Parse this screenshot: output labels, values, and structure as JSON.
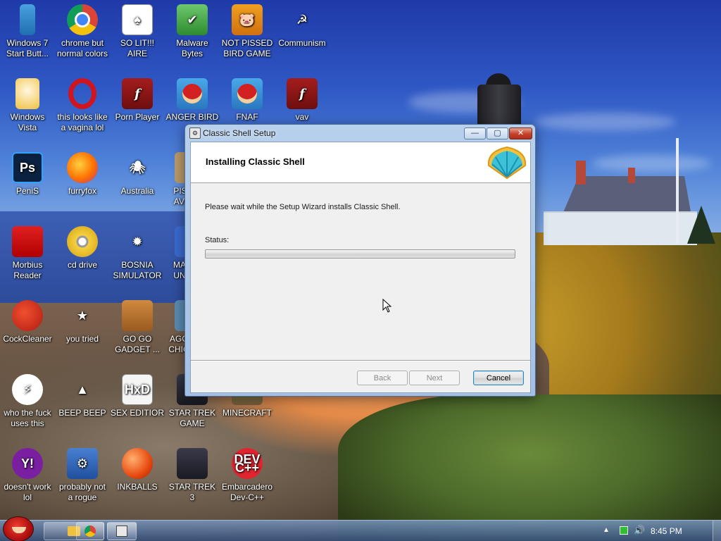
{
  "desktop": {
    "icons": [
      {
        "label": "Windows 7 Start Butt...",
        "glyph": "",
        "icon": "windows-7-start-button-icon"
      },
      {
        "label": "chrome but normal colors",
        "glyph": "",
        "icon": "chrome-icon"
      },
      {
        "label": "SO LIT!!! AIRE",
        "glyph": "♠",
        "icon": "solitaire-cards-icon"
      },
      {
        "label": "Malware Bytes",
        "glyph": "✔",
        "icon": "malwarebytes-shield-icon"
      },
      {
        "label": "NOT PISSED BIRD GAME",
        "glyph": "🐷",
        "icon": "green-pig-icon"
      },
      {
        "label": "Communism",
        "glyph": "☭",
        "icon": "communism-emblem-icon"
      },
      {
        "label": "Windows Vista",
        "glyph": "",
        "icon": "egg-icon"
      },
      {
        "label": "this looks like a vagina lol",
        "glyph": "",
        "icon": "opera-icon"
      },
      {
        "label": "Porn Player",
        "glyph": "f",
        "icon": "flash-player-icon"
      },
      {
        "label": "ANGER BIRD",
        "glyph": "",
        "icon": "angry-bird-icon"
      },
      {
        "label": "FNAF",
        "glyph": "",
        "icon": "angry-bird-icon"
      },
      {
        "label": "vav",
        "glyph": "f",
        "icon": "flash-player-icon"
      },
      {
        "label": "PeniS",
        "glyph": "Ps",
        "icon": "photoshop-icon"
      },
      {
        "label": "furryfox",
        "glyph": "",
        "icon": "firefox-icon"
      },
      {
        "label": "Australia",
        "glyph": "🕷",
        "icon": "spider-solitaire-icon"
      },
      {
        "label": "PISS AVIA",
        "glyph": "",
        "icon": "partially-hidden-icon"
      },
      {
        "label": "Morbius Reader",
        "glyph": "",
        "icon": "pdf-reader-icon"
      },
      {
        "label": "cd drive",
        "glyph": "",
        "icon": "cd-drive-icon"
      },
      {
        "label": "BOSNIA SIMULATOR",
        "glyph": "✹",
        "icon": "minesweeper-mine-icon"
      },
      {
        "label": "MA UN",
        "glyph": "",
        "icon": "partially-hidden-icon"
      },
      {
        "label": "CockCleaner",
        "glyph": "",
        "icon": "ccleaner-icon"
      },
      {
        "label": "you tried",
        "glyph": "★",
        "icon": "gold-star-icon"
      },
      {
        "label": "GO GO GADGET ...",
        "glyph": "",
        "icon": "briefcase-icon"
      },
      {
        "label": "AGC CHIC",
        "glyph": "",
        "icon": "partially-hidden-icon"
      },
      {
        "label": "who the fuck uses this",
        "glyph": "⚡",
        "icon": "lightning-bolt-icon"
      },
      {
        "label": "BEEP BEEP",
        "glyph": "▲",
        "icon": "vlc-cone-icon"
      },
      {
        "label": "SEX EDITIOR",
        "glyph": "HxD",
        "icon": "hxd-editor-icon"
      },
      {
        "label": "STAR TREK GAME",
        "glyph": "",
        "icon": "star-trek-icon"
      },
      {
        "label": "MINECRAFT",
        "glyph": "",
        "icon": "minecraft-icon"
      },
      {
        "label": "doesn't work lol",
        "glyph": "Y!",
        "icon": "yahoo-messenger-icon"
      },
      {
        "label": "probably not a rogue",
        "glyph": "⚙",
        "icon": "control-panel-gears-icon"
      },
      {
        "label": "INKBALLS",
        "glyph": "",
        "icon": "inkball-icon"
      },
      {
        "label": "STAR TREK 3",
        "glyph": "",
        "icon": "star-trek-icon"
      },
      {
        "label": "Embarcadero Dev-C++",
        "glyph": "DEV C++",
        "icon": "dev-cpp-icon"
      }
    ]
  },
  "dialog": {
    "title": "Classic Shell Setup",
    "heading": "Installing Classic Shell",
    "description": "Please wait while the Setup Wizard installs Classic Shell.",
    "status_label": "Status:",
    "progress": 0,
    "buttons": {
      "back": "Back",
      "next": "Next",
      "cancel": "Cancel"
    },
    "titlebar_buttons": {
      "minimize": "—",
      "maximize": "▢",
      "close": "✕"
    }
  },
  "taskbar": {
    "clock": "8:45 PM",
    "tray_arrow": "▲",
    "volume": "🔊"
  },
  "colors": {
    "accent": "#3c7fb1",
    "close_red": "#c5412b",
    "progress_green": "#3fbf3f"
  }
}
